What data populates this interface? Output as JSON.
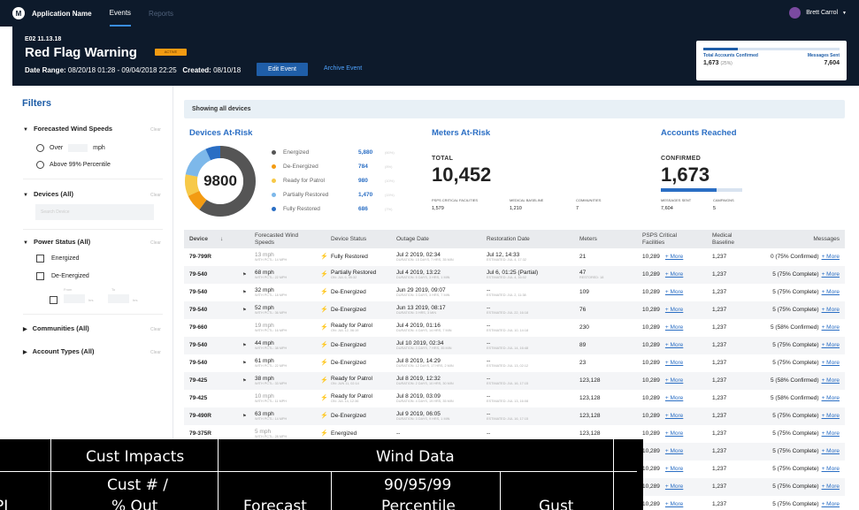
{
  "nav": {
    "app_name": "Application Name",
    "tabs": [
      "Events",
      "Reports"
    ],
    "user": "Brett Carrol"
  },
  "event": {
    "id": "E02 11.13.18",
    "title": "Red Flag Warning",
    "badge": "ACTIVE",
    "date_label": "Date Range:",
    "date_range": "08/20/18 01:28 - 09/04/2018 22:25",
    "created_label": "Created:",
    "created": "08/10/18",
    "edit_button": "Edit Event",
    "archive_button": "Archive Event"
  },
  "summary": {
    "accounts_label": "Total Accounts Confirmed",
    "messages_label": "Messages Sent",
    "accounts_value": "1,673",
    "accounts_pct": "(25%)",
    "messages_value": "7,604",
    "progress": 0.25
  },
  "filters": {
    "title": "Filters",
    "clear": "Clear",
    "wind_group": "Forecasted Wind Speeds",
    "wind_over": "Over",
    "wind_unit": "mph",
    "wind_above": "Above 99% Percentile",
    "devices_group": "Devices (All)",
    "devices_placeholder": "Search Device",
    "power_group": "Power Status (All)",
    "power_opts": [
      "Energized",
      "De-Energized"
    ],
    "range_from": "From",
    "range_to": "To",
    "range_unit1": "hrs",
    "range_unit2": "hrs",
    "communities_group": "Communities (All)",
    "account_group": "Account Types (All)"
  },
  "main": {
    "showing": "Showing all devices",
    "devices_title": "Devices At-Risk",
    "meters_title": "Meters At-Risk",
    "accounts_title": "Accounts Reached"
  },
  "devices_at_risk": {
    "total": "9800",
    "items": [
      {
        "label": "Energized",
        "value": "5,880",
        "pct": "(60%)",
        "color": "#555555",
        "share": 0.6
      },
      {
        "label": "De-Energized",
        "value": "784",
        "pct": "(8%)",
        "color": "#f39b12",
        "share": 0.08
      },
      {
        "label": "Ready for Patrol",
        "value": "980",
        "pct": "(10%)",
        "color": "#f7c948",
        "share": 0.1
      },
      {
        "label": "Partially Restored",
        "value": "1,470",
        "pct": "(15%)",
        "color": "#7db8ea",
        "share": 0.15
      },
      {
        "label": "Fully Restored",
        "value": "686",
        "pct": "(7%)",
        "color": "#2a6ec4",
        "share": 0.07
      }
    ]
  },
  "meters_at_risk": {
    "total_label": "TOTAL",
    "total": "10,452",
    "stats": [
      {
        "label": "PSPS CRITICAL FACILITIES",
        "value": "1,579"
      },
      {
        "label": "MEDICAL BASELINE",
        "value": "1,210"
      },
      {
        "label": "COMMUNITIES",
        "value": "7"
      }
    ]
  },
  "accounts_reached": {
    "confirmed_label": "CONFIRMED",
    "confirmed": "1,673",
    "progress": 0.68,
    "stats": [
      {
        "label": "MESSAGES SENT",
        "value": "7,604"
      },
      {
        "label": "CAMPAIGNS",
        "value": "5"
      }
    ]
  },
  "table": {
    "headers": [
      "Device",
      "Forecasted Wind Speeds",
      "Device Status",
      "Outage Date",
      "Restoration Date",
      "Meters",
      "PSPS Critical Facilities",
      "Medical Baseline",
      "Messages"
    ],
    "sort_icon": "↓",
    "more": "+ More",
    "rows": [
      {
        "device": "79-799R",
        "wind": "13 mph",
        "wind_sub": "WITH PCTL: 14 MPH",
        "status": "Fully Restored",
        "status_color": "#2a6ec4",
        "flag": false,
        "outage": "Jul 2 2019, 02:34",
        "outage_sub": "DURATION: 15 DAYS, 7 HRS, 35 MIN",
        "restore": "Jul 12, 14:33",
        "restore_sub": "ESTIMATED: JUL 4, 17:32",
        "meters": "21",
        "meters_sub": "",
        "psps": "10,289",
        "medical": "1,237",
        "messages": "0 (75% Confirmed)"
      },
      {
        "device": "79-540",
        "wind": "68 mph",
        "wind_sub": "WITH PCTL: 22 MPH",
        "status": "Partially Restored",
        "status_color": "#7db8ea",
        "status_sub": "ON: JUL 6, 05:32",
        "flag": true,
        "outage": "Jul 4 2019, 13:22",
        "outage_sub": "DURATION: 5 DAYS, 3 HRS, 1 MIN",
        "restore": "Jul 6, 01:25 (Partial)",
        "restore_sub": "ESTIMATED: JUL 4, 16:02",
        "meters": "47",
        "meters_sub": "RESTORED: 18",
        "psps": "10,289",
        "medical": "1,237",
        "messages": "5 (75% Complete)"
      },
      {
        "device": "79-540",
        "wind": "32 mph",
        "wind_sub": "WITH PCTL: 18 MPH",
        "status": "De-Energized",
        "status_color": "#f39b12",
        "flag": true,
        "outage": "Jun 29 2019, 09:07",
        "outage_sub": "DURATION: 3 DAYS, 3 HRS, 7 MIN",
        "restore": "--",
        "restore_sub": "ESTIMATED: JUL 2, 11:38",
        "meters": "109",
        "meters_sub": "",
        "psps": "10,289",
        "medical": "1,237",
        "messages": "5 (75% Complete)"
      },
      {
        "device": "79-540",
        "wind": "52 mph",
        "wind_sub": "WITH PCTL: 36 MPH",
        "status": "De-Energized",
        "status_color": "#f39b12",
        "flag": true,
        "outage": "Jun 13 2019, 08:17",
        "outage_sub": "DURATION: 3 HRS, 3 MIN",
        "restore": "--",
        "restore_sub": "ESTIMATED: JUL 22, 16:18",
        "meters": "76",
        "meters_sub": "",
        "psps": "10,289",
        "medical": "1,237",
        "messages": "5 (75% Complete)"
      },
      {
        "device": "79-660",
        "wind": "19 mph",
        "wind_sub": "WITH PCTL: 16 MPH",
        "status": "Ready for Patrol",
        "status_color": "#f7c948",
        "status_sub": "ON: JUL 12, 06:19",
        "flag": false,
        "outage": "Jul 4 2019, 01:16",
        "outage_sub": "DURATION: 4 DAYS, 14 HRS, 7 MIN",
        "restore": "--",
        "restore_sub": "ESTIMATED: JUL 10, 14:18",
        "meters": "230",
        "meters_sub": "",
        "psps": "10,289",
        "medical": "1,237",
        "messages": "5 (58% Confirmed)"
      },
      {
        "device": "79-540",
        "wind": "44 mph",
        "wind_sub": "WITH PCTL: 38 MPH",
        "status": "De-Energized",
        "status_color": "#f39b12",
        "flag": true,
        "outage": "Jul 10 2019, 02:34",
        "outage_sub": "DURATION: 3 DAYS, 7 HRS, 35 MIN",
        "restore": "--",
        "restore_sub": "ESTIMATED: JUL 14, 16:48",
        "meters": "89",
        "meters_sub": "",
        "psps": "10,289",
        "medical": "1,237",
        "messages": "5 (75% Complete)"
      },
      {
        "device": "79-540",
        "wind": "61 mph",
        "wind_sub": "WITH PCTL: 22 MPH",
        "status": "De-Energized",
        "status_color": "#f39b12",
        "flag": true,
        "outage": "Jul 8 2019, 14:29",
        "outage_sub": "DURATION: 12 DAYS, 17 HRS, 2 MIN",
        "restore": "--",
        "restore_sub": "ESTIMATED: JUL 13, 02:12",
        "meters": "23",
        "meters_sub": "",
        "psps": "10,289",
        "medical": "1,237",
        "messages": "5 (75% Complete)"
      },
      {
        "device": "79-425",
        "wind": "38 mph",
        "wind_sub": "WITH PCTL: 33 MPH",
        "status": "Ready for Patrol",
        "status_color": "#f7c948",
        "status_sub": "ON: JUN 11, 02:14",
        "flag": true,
        "outage": "Jul 8 2019, 12:32",
        "outage_sub": "DURATION: 2 DAYS, 10 HRS, 30 MIN",
        "restore": "--",
        "restore_sub": "ESTIMATED: JUL 16, 17:15",
        "meters": "123,128",
        "meters_sub": "",
        "psps": "10,289",
        "medical": "1,237",
        "messages": "5 (58% Confirmed)"
      },
      {
        "device": "79-425",
        "wind": "10 mph",
        "wind_sub": "WITH PCTL: 11 MPH",
        "status": "Ready for Patrol",
        "status_color": "#f7c948",
        "status_sub": "ON: JUL 14, 12:36",
        "flag": false,
        "outage": "Jul 8 2019, 03:09",
        "outage_sub": "DURATION: 4 DAYS, 19 HRS, 35 MIN",
        "restore": "--",
        "restore_sub": "ESTIMATED: JUL 13, 16:08",
        "meters": "123,128",
        "meters_sub": "",
        "psps": "10,289",
        "medical": "1,237",
        "messages": "5 (58% Confirmed)"
      },
      {
        "device": "79-490R",
        "wind": "63 mph",
        "wind_sub": "WITH PCTL: 14 MPH",
        "status": "De-Energized",
        "status_color": "#f39b12",
        "flag": true,
        "outage": "Jul 9 2019, 06:05",
        "outage_sub": "DURATION: 3 DAYS, 9 HRS, 1 MIN",
        "restore": "--",
        "restore_sub": "ESTIMATED: JUL 16, 17:15",
        "meters": "123,128",
        "meters_sub": "",
        "psps": "10,289",
        "medical": "1,237",
        "messages": "5 (75% Complete)"
      },
      {
        "device": "79-375R",
        "wind": "5 mph",
        "wind_sub": "WITH PCTL: 28 MPH",
        "status": "Energized",
        "status_color": "#555555",
        "flag": false,
        "outage": "--",
        "outage_sub": "",
        "restore": "--",
        "restore_sub": "",
        "meters": "123,128",
        "meters_sub": "",
        "psps": "10,289",
        "medical": "1,237",
        "messages": "5 (75% Complete)"
      },
      {
        "device": "",
        "wind": "",
        "wind_sub": "",
        "status": "",
        "status_color": "#555555",
        "flag": false,
        "outage": "",
        "outage_sub": "",
        "restore": "",
        "restore_sub": "",
        "meters": "",
        "meters_sub": "",
        "psps": "10,289",
        "medical": "1,237",
        "messages": "5 (75% Complete)"
      },
      {
        "device": "",
        "wind": "",
        "wind_sub": "",
        "status": "",
        "status_color": "#555555",
        "flag": false,
        "outage": "",
        "outage_sub": "",
        "restore": "",
        "restore_sub": "",
        "meters": "",
        "meters_sub": "",
        "psps": "10,289",
        "medical": "1,237",
        "messages": "5 (75% Complete)"
      },
      {
        "device": "",
        "wind": "",
        "wind_sub": "",
        "status": "",
        "status_color": "#555555",
        "flag": false,
        "outage": "",
        "outage_sub": "",
        "restore": "",
        "restore_sub": "",
        "meters": "",
        "meters_sub": "",
        "psps": "10,289",
        "medical": "1,237",
        "messages": "5 (75% Complete)"
      },
      {
        "device": "",
        "wind": "",
        "wind_sub": "",
        "status": "",
        "status_color": "#555555",
        "flag": false,
        "outage": "",
        "outage_sub": "",
        "restore": "",
        "restore_sub": "",
        "meters": "",
        "meters_sub": "",
        "psps": "10,289",
        "medical": "1,237",
        "messages": "5 (75% Complete)"
      }
    ]
  },
  "overlay": {
    "headers": [
      "Cust Impacts",
      "Wind Data"
    ],
    "sub1": "Cust # /",
    "sub2": "% Out",
    "sub3": "Forecast",
    "sub4": "90/95/99",
    "sub5": "Percentile",
    "sub6": "Gust",
    "left_fragment": "PI"
  }
}
